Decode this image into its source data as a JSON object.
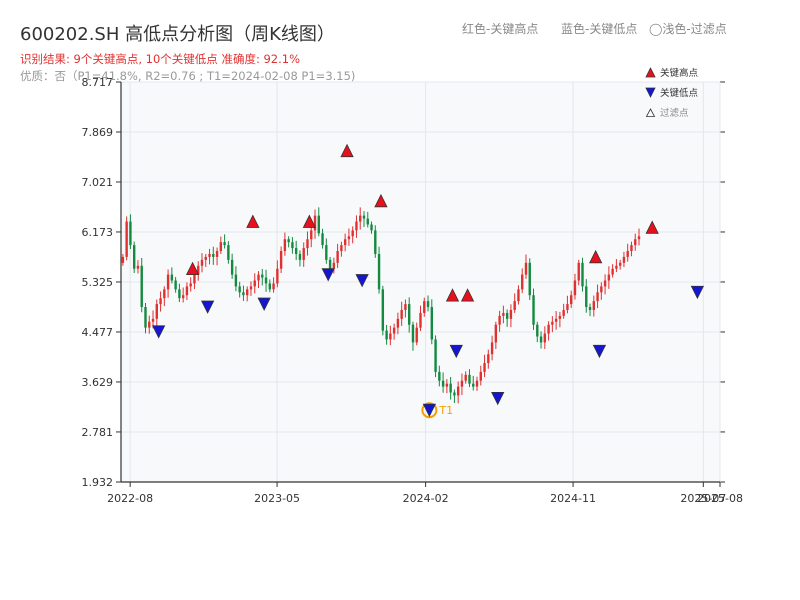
{
  "header": {
    "title": "600202.SH 高低点分析图（周K线图）",
    "legend_hint_high": "红色-关键高点",
    "legend_hint_low": "蓝色-关键低点",
    "legend_hint_filtered": "◯浅色-过滤点",
    "result_line": "识别结果: 9个关键高点, 10个关键低点   准确度: 92.1%",
    "quality_line": "优质：否（P1=41.8%, R2=0.76 ; T1=2024-02-08 P1=3.15)"
  },
  "legend": {
    "high": "关键高点",
    "low": "关键低点",
    "filtered": "过滤点"
  },
  "colors": {
    "up": "#e03131",
    "down": "#138a3f",
    "high_marker": "#e8101c",
    "low_marker": "#1515d4",
    "t1_ring": "#f59f00",
    "plot_bg": "#f7f9fb",
    "grid": "#e3e7ec",
    "axis": "#333333"
  },
  "chart_data": {
    "type": "candlestick",
    "x_unit": "week",
    "x_range": [
      "2022-07-15",
      "2025-08-01"
    ],
    "ylim": [
      1.932,
      8.717
    ],
    "y_ticks": [
      1.932,
      2.781,
      3.629,
      4.477,
      5.325,
      6.173,
      7.021,
      7.869,
      8.717
    ],
    "x_ticks": [
      {
        "label": "2022-08",
        "date": "2022-08-01"
      },
      {
        "label": "2023-05",
        "date": "2023-05-01"
      },
      {
        "label": "2024-02",
        "date": "2024-02-01"
      },
      {
        "label": "2024-11",
        "date": "2024-11-01"
      },
      {
        "label": "2025-07",
        "date": "2025-07-01"
      },
      {
        "label": "2025-08",
        "date": "2025-08-01"
      }
    ],
    "weekly_close": [
      5.75,
      6.35,
      5.95,
      5.55,
      5.6,
      4.9,
      4.55,
      4.65,
      4.7,
      4.95,
      5.05,
      5.2,
      5.45,
      5.35,
      5.2,
      5.05,
      5.1,
      5.25,
      5.3,
      5.45,
      5.6,
      5.7,
      5.75,
      5.8,
      5.75,
      5.85,
      6.0,
      5.95,
      5.7,
      5.45,
      5.25,
      5.15,
      5.1,
      5.2,
      5.25,
      5.35,
      5.45,
      5.4,
      5.3,
      5.2,
      5.3,
      5.55,
      5.85,
      6.05,
      6.0,
      5.9,
      5.8,
      5.7,
      5.9,
      6.05,
      6.2,
      6.45,
      6.15,
      5.95,
      5.7,
      5.55,
      5.65,
      5.85,
      5.95,
      6.05,
      6.1,
      6.2,
      6.35,
      6.45,
      6.4,
      6.3,
      6.2,
      5.8,
      5.2,
      4.5,
      4.35,
      4.45,
      4.55,
      4.7,
      4.85,
      4.95,
      4.6,
      4.3,
      4.55,
      4.8,
      5.0,
      4.9,
      4.35,
      3.8,
      3.65,
      3.55,
      3.6,
      3.45,
      3.4,
      3.55,
      3.65,
      3.75,
      3.6,
      3.55,
      3.65,
      3.8,
      3.95,
      4.1,
      4.3,
      4.6,
      4.75,
      4.8,
      4.7,
      4.85,
      5.0,
      5.2,
      5.45,
      5.65,
      5.1,
      4.6,
      4.4,
      4.3,
      4.45,
      4.6,
      4.65,
      4.7,
      4.75,
      4.85,
      4.95,
      5.1,
      5.35,
      5.65,
      5.25,
      4.9,
      4.85,
      5.0,
      5.15,
      5.25,
      5.35,
      5.45,
      5.55,
      5.6,
      5.65,
      5.75,
      5.85,
      5.95,
      6.05,
      6.1
    ],
    "key_highs": [
      {
        "date": "2022-11-25",
        "value": 5.45
      },
      {
        "date": "2023-03-17",
        "value": 6.25
      },
      {
        "date": "2023-06-30",
        "value": 6.25
      },
      {
        "date": "2023-09-08",
        "value": 7.45
      },
      {
        "date": "2023-11-10",
        "value": 6.6
      },
      {
        "date": "2024-03-22",
        "value": 5.0
      },
      {
        "date": "2024-04-19",
        "value": 5.0
      },
      {
        "date": "2024-12-13",
        "value": 5.65
      },
      {
        "date": "2025-03-28",
        "value": 6.15
      }
    ],
    "key_lows": [
      {
        "date": "2022-09-23",
        "value": 4.48
      },
      {
        "date": "2022-12-23",
        "value": 4.9
      },
      {
        "date": "2023-04-07",
        "value": 4.95
      },
      {
        "date": "2023-08-04",
        "value": 5.45
      },
      {
        "date": "2023-10-06",
        "value": 5.35
      },
      {
        "date": "2024-02-08",
        "value": 3.15
      },
      {
        "date": "2024-03-29",
        "value": 4.15
      },
      {
        "date": "2024-06-14",
        "value": 3.35
      },
      {
        "date": "2024-12-20",
        "value": 4.15
      },
      {
        "date": "2025-06-20",
        "value": 5.15
      }
    ],
    "t1": {
      "label": "T1",
      "date": "2024-02-08",
      "value": 3.15
    }
  }
}
